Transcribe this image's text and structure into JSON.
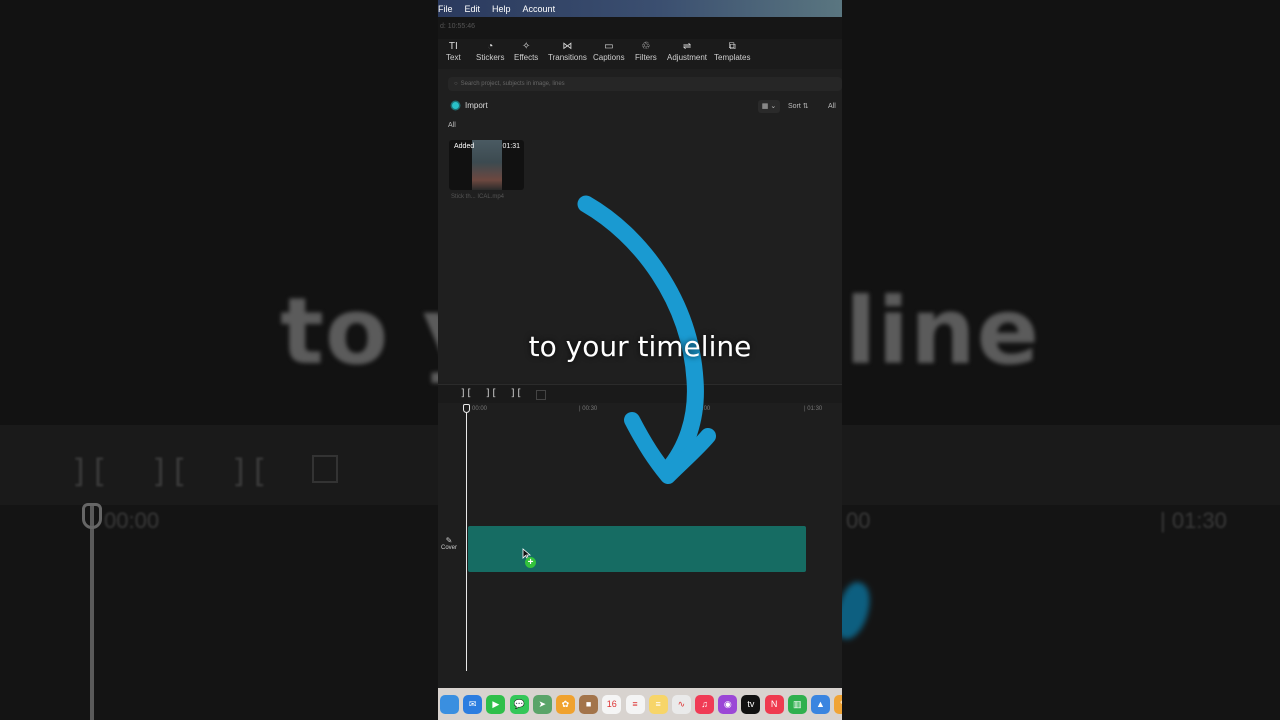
{
  "background": {
    "big_text_left": "to y",
    "big_text_right": "line",
    "tools": [
      "][",
      "][",
      "]["
    ],
    "time_left": "00:00",
    "time_mid": "00",
    "time_right": "| 01:30"
  },
  "menubar": {
    "items": [
      "File",
      "Edit",
      "Help",
      "Account"
    ]
  },
  "subbar": {
    "timecode": "d: 10:55:46"
  },
  "toolbar": {
    "tools": [
      {
        "label": "Text",
        "icon": "TI"
      },
      {
        "label": "Stickers",
        "icon": "◔"
      },
      {
        "label": "Effects",
        "icon": "✧"
      },
      {
        "label": "Transitions",
        "icon": "⋈"
      },
      {
        "label": "Captions",
        "icon": "▭"
      },
      {
        "label": "Filters",
        "icon": "♲"
      },
      {
        "label": "Adjustment",
        "icon": "⇌"
      },
      {
        "label": "Templates",
        "icon": "⧉"
      }
    ]
  },
  "media": {
    "search_placeholder": "Search project, subjects in image, lines",
    "import_label": "Import",
    "sort_label": "Sort",
    "all_filter": "All",
    "all_label": "All",
    "clip": {
      "badge": "Added",
      "duration": "01:31",
      "filename": "Stick th... ICAL.mp4"
    }
  },
  "timeline": {
    "tools": [
      "][",
      "][",
      "]["
    ],
    "ruler": [
      "00:00",
      "| 00:30",
      "| 01:00",
      "| 01:30"
    ],
    "cover_label": "Cover",
    "plus": "+"
  },
  "overlay": {
    "caption": "to your timeline",
    "arrow_color": "#1a9ad1"
  },
  "dock": {
    "icons": [
      {
        "name": "finder",
        "color": "#3a8fe0",
        "glyph": ""
      },
      {
        "name": "mail",
        "color": "#2c7de0",
        "glyph": "✉"
      },
      {
        "name": "facetime",
        "color": "#2fbf4a",
        "glyph": "▶"
      },
      {
        "name": "messages",
        "color": "#34c759",
        "glyph": "💬"
      },
      {
        "name": "maps",
        "color": "#5aa469",
        "glyph": "➤"
      },
      {
        "name": "photos",
        "color": "#f0a22e",
        "glyph": "✿"
      },
      {
        "name": "notes-brown",
        "color": "#a3744a",
        "glyph": "■"
      },
      {
        "name": "calendar",
        "color": "#f5f5f5",
        "glyph": "16"
      },
      {
        "name": "reminders",
        "color": "#f4f4f4",
        "glyph": "≡"
      },
      {
        "name": "notes",
        "color": "#f7d569",
        "glyph": "≡"
      },
      {
        "name": "freeform",
        "color": "#eaeaea",
        "glyph": "∿"
      },
      {
        "name": "music",
        "color": "#f03b55",
        "glyph": "♫"
      },
      {
        "name": "podcasts",
        "color": "#9b47d6",
        "glyph": "◉"
      },
      {
        "name": "tv",
        "color": "#111111",
        "glyph": "tv"
      },
      {
        "name": "news",
        "color": "#ef3b4f",
        "glyph": "N"
      },
      {
        "name": "numbers",
        "color": "#2fb04e",
        "glyph": "▥"
      },
      {
        "name": "keynote",
        "color": "#3a85e0",
        "glyph": "▲"
      },
      {
        "name": "pages",
        "color": "#f0a436",
        "glyph": "✎"
      }
    ]
  }
}
